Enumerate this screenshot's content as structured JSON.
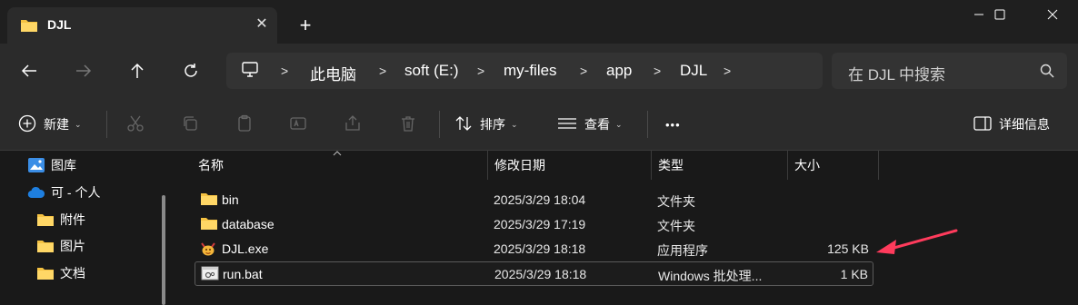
{
  "window": {
    "tab_title": "DJL",
    "tab_close": "✕",
    "new_tab": "+"
  },
  "navigation": {
    "breadcrumbs": [
      "此电脑",
      "soft (E:)",
      "my-files",
      "app",
      "DJL"
    ],
    "search_placeholder": "在 DJL 中搜索"
  },
  "toolbar": {
    "new_label": "新建",
    "sort_label": "排序",
    "view_label": "查看",
    "more_label": "•••",
    "details_label": "详细信息"
  },
  "sidebar": {
    "items": [
      {
        "label": "图库",
        "icon": "gallery-icon"
      },
      {
        "label": "可 - 个人",
        "icon": "onedrive-cloud-icon"
      },
      {
        "label": "附件",
        "icon": "folder-icon"
      },
      {
        "label": "图片",
        "icon": "folder-icon"
      },
      {
        "label": "文档",
        "icon": "folder-icon"
      }
    ]
  },
  "columns": {
    "name": "名称",
    "modified": "修改日期",
    "type": "类型",
    "size": "大小"
  },
  "files": [
    {
      "name": "bin",
      "modified": "2025/3/29 18:04",
      "type": "文件夹",
      "size": "",
      "icon": "folder-icon"
    },
    {
      "name": "database",
      "modified": "2025/3/29 17:19",
      "type": "文件夹",
      "size": "",
      "icon": "folder-icon"
    },
    {
      "name": "DJL.exe",
      "modified": "2025/3/29 18:18",
      "type": "应用程序",
      "size": "125 KB",
      "icon": "exe-app-icon"
    },
    {
      "name": "run.bat",
      "modified": "2025/3/29 18:18",
      "type": "Windows 批处理...",
      "size": "1 KB",
      "icon": "batch-file-icon"
    }
  ],
  "colors": {
    "folder": "#f5c242",
    "annotation_arrow": "#ff3b5c",
    "accent": "#4cc2ff"
  }
}
